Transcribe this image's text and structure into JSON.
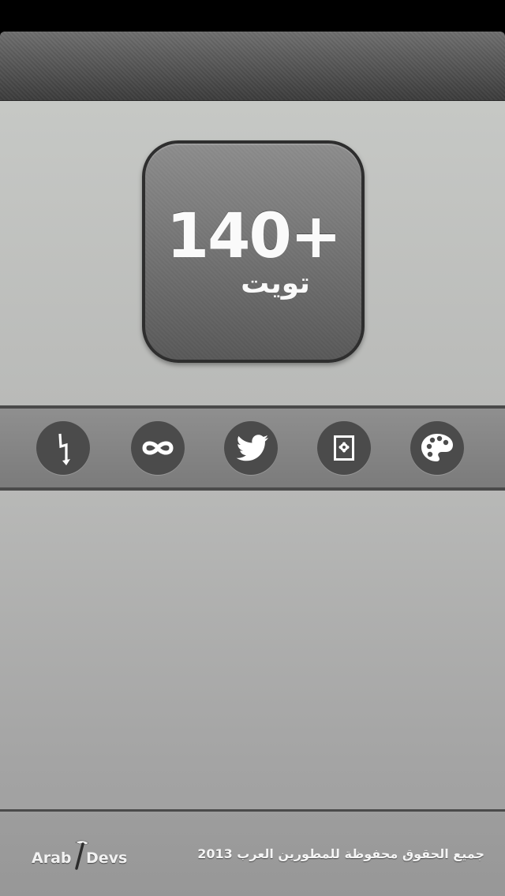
{
  "app": {
    "logo_number": "140+",
    "logo_word": "تويت"
  },
  "toolbar": {
    "buttons": [
      {
        "icon": "lightning-icon"
      },
      {
        "icon": "infinity-icon"
      },
      {
        "icon": "twitter-bird-icon"
      },
      {
        "icon": "photo-icon"
      },
      {
        "icon": "palette-icon"
      }
    ]
  },
  "footer": {
    "brand_left": "Arab",
    "brand_right": "Devs",
    "copyright": "جميع الحقوق محفوظة للمطورين العرب 2013"
  },
  "colors": {
    "nav_bar": "#4f4f4f",
    "background": "#c6c8c5",
    "icon_circle": "#4b4b4b",
    "text": "#ffffff"
  }
}
